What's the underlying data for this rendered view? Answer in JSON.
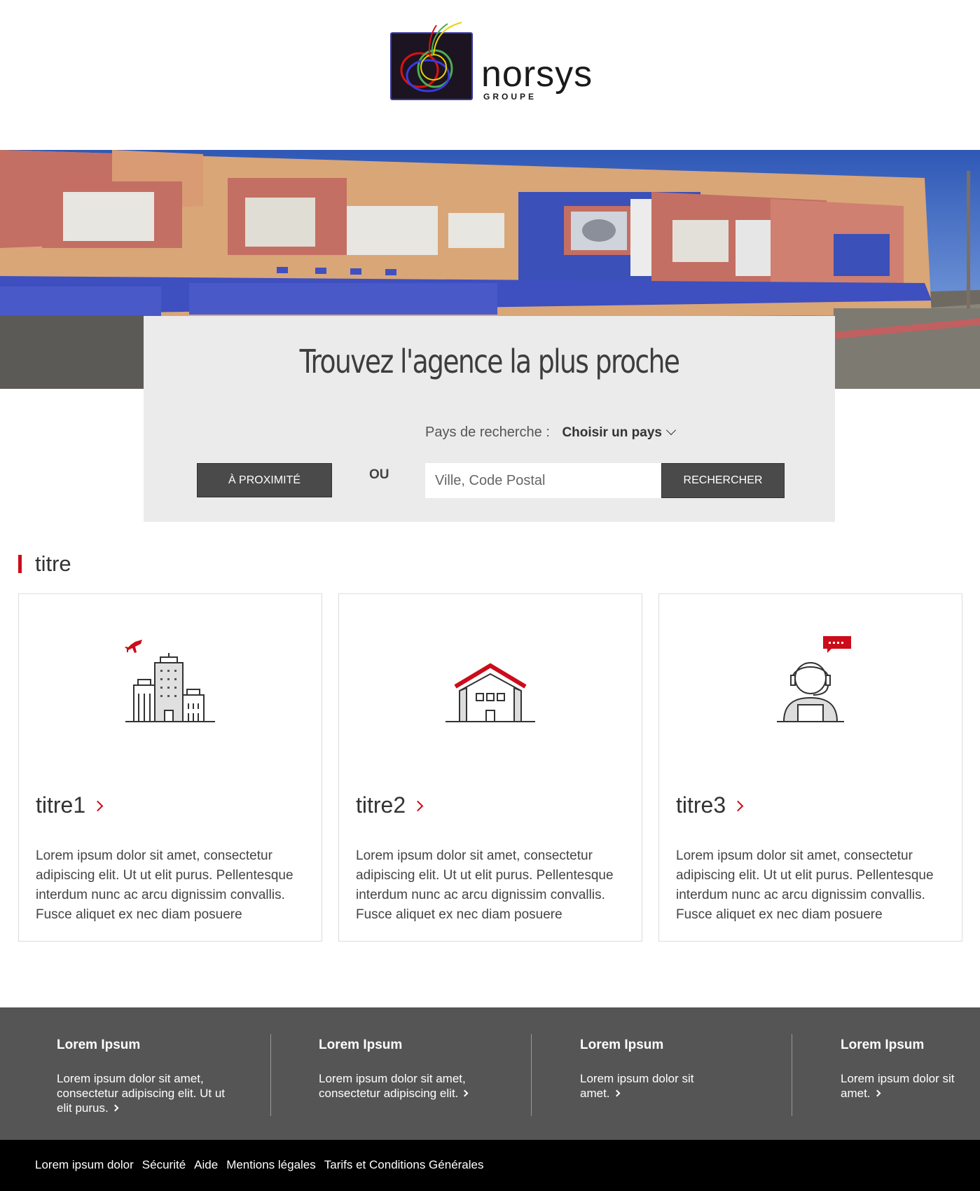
{
  "header": {
    "logo_word": "norsys",
    "logo_sub": "GROUPE"
  },
  "search": {
    "title": "Trouvez l'agence la plus proche",
    "country_label": "Pays de recherche :",
    "country_select": "Choisir un pays",
    "nearby_button": "À PROXIMITÉ",
    "or_label": "OU",
    "city_placeholder": "Ville, Code Postal",
    "search_button": "RECHERCHER"
  },
  "section": {
    "title": "titre"
  },
  "cards": [
    {
      "title": "titre1",
      "icon": "city-buildings-icon",
      "text": "Lorem ipsum dolor sit amet, consectetur adipiscing elit. Ut ut elit purus. Pellentesque interdum nunc ac arcu dignissim convallis. Fusce aliquet ex nec diam posuere"
    },
    {
      "title": "titre2",
      "icon": "house-icon",
      "text": "Lorem ipsum dolor sit amet, consectetur adipiscing elit. Ut ut elit purus. Pellentesque interdum nunc ac arcu dignissim convallis. Fusce aliquet ex nec diam posuere"
    },
    {
      "title": "titre3",
      "icon": "support-agent-icon",
      "text": "Lorem ipsum dolor sit amet, consectetur adipiscing elit. Ut ut elit purus. Pellentesque interdum nunc ac arcu dignissim convallis. Fusce aliquet ex nec diam posuere"
    }
  ],
  "footer": {
    "columns": [
      {
        "heading": "Lorem Ipsum",
        "text": "Lorem ipsum dolor sit amet, consectetur adipiscing elit. Ut ut elit purus."
      },
      {
        "heading": "Lorem Ipsum",
        "text": "Lorem ipsum dolor sit amet, consectetur adipiscing elit."
      },
      {
        "heading": "Lorem Ipsum",
        "text": "Lorem ipsum dolor sit amet."
      },
      {
        "heading": "Lorem Ipsum",
        "text": "Lorem ipsum dolor sit amet."
      }
    ]
  },
  "bottom_links": [
    "Lorem ipsum dolor",
    "Sécurité",
    "Aide",
    "Mentions légales",
    "Tarifs et Conditions Générales"
  ],
  "colors": {
    "accent": "#cc0c1a",
    "dark_button": "#4a4a4a",
    "search_panel": "#ebebeb",
    "footer": "#555555",
    "bottom_bar": "#000000"
  }
}
